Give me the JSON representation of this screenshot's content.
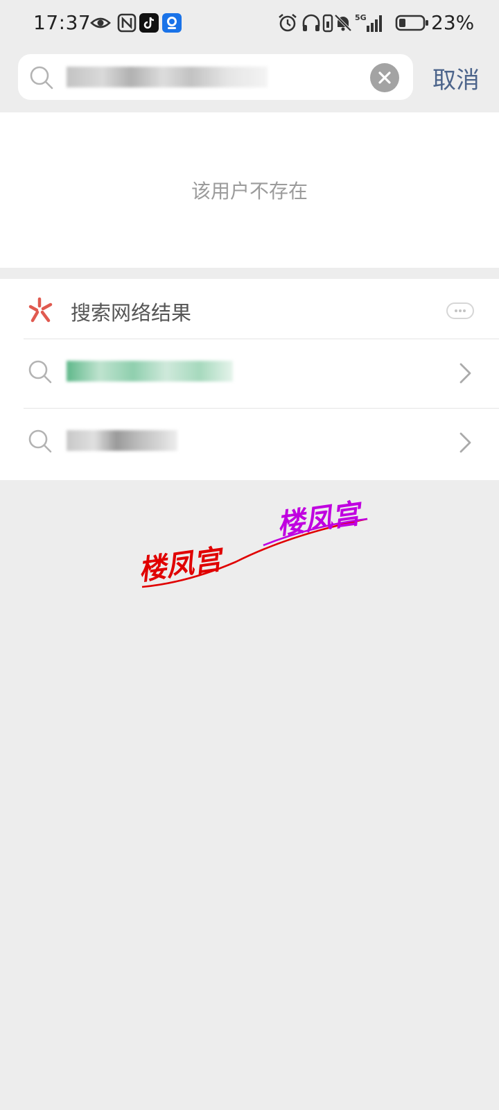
{
  "status_bar": {
    "time": "17:37",
    "battery": "23%",
    "network": "5G",
    "icons": [
      "eye-icon",
      "nfc-icon",
      "tiktok-icon",
      "app-icon",
      "alarm-icon",
      "headphones-icon",
      "vibrate-icon",
      "mute-icon",
      "signal-icon",
      "battery-icon"
    ]
  },
  "search": {
    "cancel_label": "取消"
  },
  "empty_state": {
    "message": "该用户不存在"
  },
  "web_results": {
    "title": "搜索网络结果",
    "logo_color": "#e05a50"
  },
  "watermark": {
    "text": "楼凤宫",
    "colors": [
      "#e00000",
      "#c000e0"
    ]
  }
}
